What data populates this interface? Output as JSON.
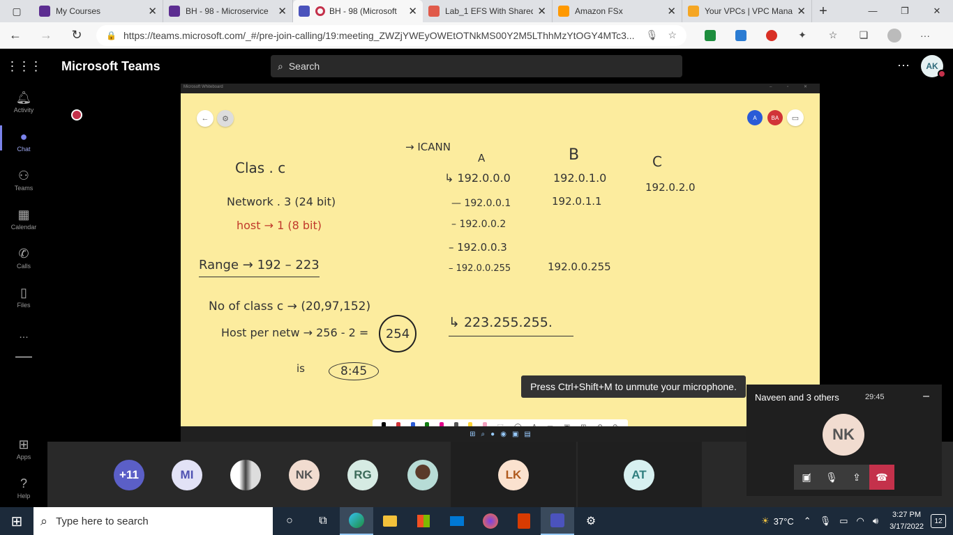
{
  "browser": {
    "tabs": [
      {
        "title": "My Courses",
        "color": "#5c2d91"
      },
      {
        "title": "BH - 98 - Microservice",
        "color": "#5c2d91"
      },
      {
        "title": "BH - 98 (Microsoft",
        "color": "#4b53bc",
        "active": true
      },
      {
        "title": "Lab_1 EFS With Shared",
        "color": "#e05a4a"
      },
      {
        "title": "Amazon FSx",
        "color": "#f90"
      },
      {
        "title": "Your VPCs | VPC Mana",
        "color": "#f5a623"
      }
    ],
    "url": "https://teams.microsoft.com/_#/pre-join-calling/19:meeting_ZWZjYWEyOWEtOTNkMS00Y2M5LThhMzYtOGY4MTc3..."
  },
  "teams": {
    "app_name": "Microsoft Teams",
    "search_placeholder": "Search",
    "user_initials": "AK",
    "rail": [
      {
        "label": "Activity",
        "icon": "bell-icon"
      },
      {
        "label": "Chat",
        "icon": "chat-icon"
      },
      {
        "label": "Teams",
        "icon": "teams-icon"
      },
      {
        "label": "Calendar",
        "icon": "calendar-icon"
      },
      {
        "label": "Calls",
        "icon": "phone-icon"
      },
      {
        "label": "Files",
        "icon": "file-icon"
      },
      {
        "label": "...",
        "icon": "more-icon"
      },
      {
        "label": "Apps",
        "icon": "apps-icon"
      },
      {
        "label": "Help",
        "icon": "help-icon"
      }
    ]
  },
  "whiteboard": {
    "window_title": "Microsoft Whiteboard",
    "presenters": [
      {
        "initials": "A",
        "color": "#2a5bd7"
      },
      {
        "initials": "BA",
        "color": "#d13438"
      }
    ],
    "notes": {
      "class_c": "Clas . c",
      "network": "Network . 3 (24 bit)",
      "host": "host → 1 (8 bit)",
      "range": "Range → 192 – 223",
      "no_of_class": "No of class c → (20,97,152)",
      "host_per_network": "Host per netw → 256 - 2 =",
      "circled": "254",
      "is": "is",
      "time": "8:45",
      "icann": "→ ICANN",
      "col_a": "A",
      "col_b": "B",
      "col_c": "C",
      "a_rows": [
        "↳ 192.0.0.0",
        "— 192.0.0.1",
        "– 192.0.0.2",
        "– 192.0.0.3",
        "– 192.0.0.255"
      ],
      "b_rows": [
        "192.0.1.0",
        "192.0.1.1",
        "192.0.0.255"
      ],
      "c_row": "192.0.2.0",
      "broadcast": "↳ 223.255.255."
    },
    "toast": "Press Ctrl+Shift+M to unmute your microphone."
  },
  "participants": {
    "items": [
      {
        "initials": "+11",
        "bg": "#5b5fc7",
        "fg": "#ffffff"
      },
      {
        "initials": "MI",
        "bg": "#e2e2f6",
        "fg": "#4f52b2"
      },
      {
        "initials": "",
        "bg": "#d8d8d8",
        "fg": "#333333"
      },
      {
        "initials": "NK",
        "bg": "#f1dcd0",
        "fg": "#555555"
      },
      {
        "initials": "RG",
        "bg": "#d6ebe3",
        "fg": "#3b6a59"
      },
      {
        "initials": "",
        "bg": "#b7dcd6",
        "fg": "#333333"
      },
      {
        "initials": "LK",
        "bg": "#fbe2cf",
        "fg": "#b05a1d"
      },
      {
        "initials": "AT",
        "bg": "#d7f0f0",
        "fg": "#2f7e7e"
      }
    ]
  },
  "mini_call": {
    "title": "Naveen and 3 others",
    "duration": "29:45",
    "avatar": "NK"
  },
  "taskbar": {
    "search_placeholder": "Type here to search",
    "temperature": "37°C",
    "time": "3:27 PM",
    "date": "3/17/2022",
    "notifications": "12"
  }
}
